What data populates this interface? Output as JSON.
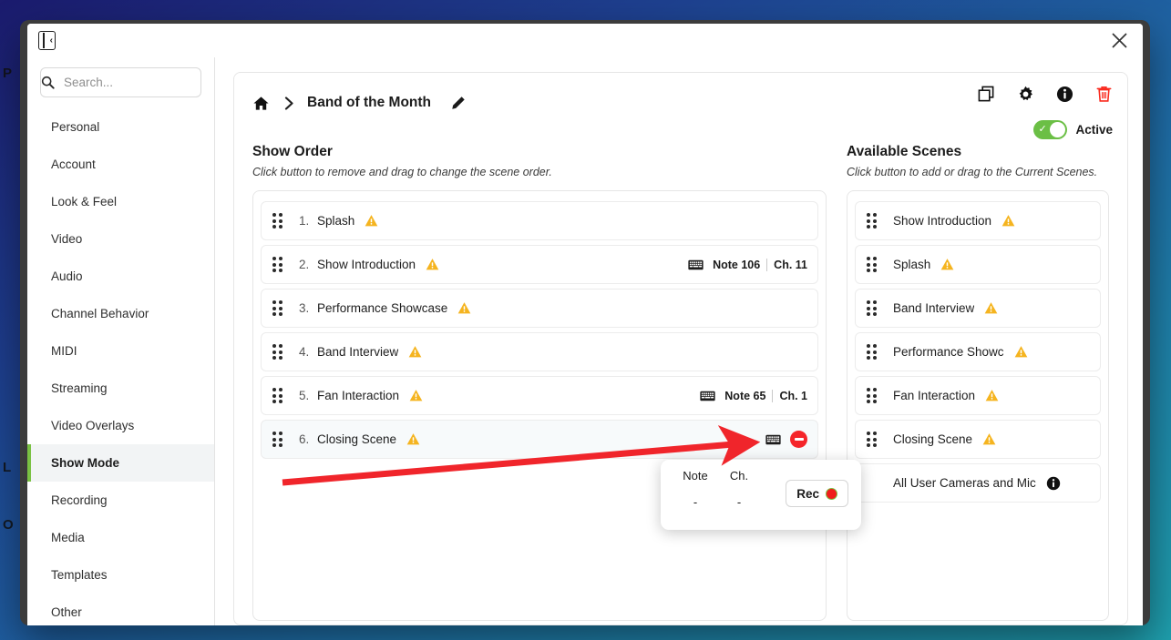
{
  "window": {
    "collapse_icon": "panel-collapse-icon",
    "close_icon": "close-icon"
  },
  "search": {
    "placeholder": "Search...",
    "value": "",
    "icon": "search-icon"
  },
  "sidebar": {
    "items": [
      {
        "label": "Personal",
        "active": false
      },
      {
        "label": "Account",
        "active": false
      },
      {
        "label": "Look & Feel",
        "active": false
      },
      {
        "label": "Video",
        "active": false
      },
      {
        "label": "Audio",
        "active": false
      },
      {
        "label": "Channel Behavior",
        "active": false
      },
      {
        "label": "MIDI",
        "active": false
      },
      {
        "label": "Streaming",
        "active": false
      },
      {
        "label": "Video Overlays",
        "active": false
      },
      {
        "label": "Show Mode",
        "active": true
      },
      {
        "label": "Recording",
        "active": false
      },
      {
        "label": "Media",
        "active": false
      },
      {
        "label": "Templates",
        "active": false
      },
      {
        "label": "Other",
        "active": false
      }
    ]
  },
  "header": {
    "home_icon": "home-icon",
    "separator": "›",
    "title": "Band of the Month",
    "edit_icon": "pencil-icon",
    "icons": [
      {
        "name": "duplicate-icon",
        "label": "Duplicate"
      },
      {
        "name": "gear-icon",
        "label": "Settings"
      },
      {
        "name": "info-icon",
        "label": "Info"
      },
      {
        "name": "trash-icon",
        "label": "Delete"
      }
    ],
    "toggle": {
      "label": "Active",
      "on": true,
      "color": "#6bbf45"
    }
  },
  "show_order": {
    "title": "Show Order",
    "hint": "Click button to remove and drag to change the scene order.",
    "rows": [
      {
        "index": "1.",
        "name": "Splash",
        "warn": true,
        "note": "",
        "channel": "",
        "hovered": false
      },
      {
        "index": "2.",
        "name": "Show Introduction",
        "warn": true,
        "note": "Note 106",
        "channel": "Ch. 11",
        "hovered": false
      },
      {
        "index": "3.",
        "name": "Performance Showcase",
        "warn": true,
        "note": "",
        "channel": "",
        "hovered": false
      },
      {
        "index": "4.",
        "name": "Band Interview",
        "warn": true,
        "note": "",
        "channel": "",
        "hovered": false
      },
      {
        "index": "5.",
        "name": "Fan Interaction",
        "warn": true,
        "note": "Note 65",
        "channel": "Ch. 1",
        "hovered": false
      },
      {
        "index": "6.",
        "name": "Closing Scene",
        "warn": true,
        "note": "",
        "channel": "",
        "hovered": true
      }
    ]
  },
  "available_scenes": {
    "title": "Available Scenes",
    "hint": "Click button to add or drag to the Current Scenes.",
    "rows": [
      {
        "name": "Show Introduction",
        "warn": true,
        "info": false
      },
      {
        "name": "Splash",
        "warn": true,
        "info": false
      },
      {
        "name": "Band Interview",
        "warn": true,
        "info": false
      },
      {
        "name": "Performance Showc",
        "warn": true,
        "info": false
      },
      {
        "name": "Fan Interaction",
        "warn": true,
        "info": false
      },
      {
        "name": "Closing Scene",
        "warn": true,
        "info": false
      },
      {
        "name": "All User Cameras and Mic",
        "warn": false,
        "info": true
      }
    ]
  },
  "midi_popup": {
    "note_label": "Note",
    "note_value": "-",
    "channel_label": "Ch.",
    "channel_value": "-",
    "rec_label": "Rec"
  },
  "ghost_background": {
    "labels": [
      "P",
      "L",
      "O"
    ]
  },
  "colors": {
    "accent_green": "#6bbf45",
    "warning": "#f5b41f",
    "danger": "#f5252a",
    "annotation": "#f0252b"
  }
}
